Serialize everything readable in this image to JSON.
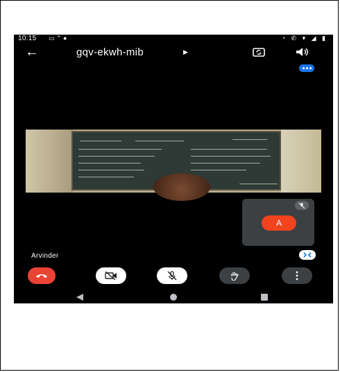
{
  "status_bar": {
    "time": "10:15"
  },
  "header": {
    "meeting_code": "gqv-ekwh-mib"
  },
  "participant": {
    "name": "Arvinder"
  },
  "self_view": {
    "avatar_letter": "A"
  },
  "colors": {
    "end_call": "#ea4335",
    "accent": "#1a73e8",
    "avatar": "#f0431e"
  },
  "icons": [
    "back-arrow-icon",
    "chevron-right-icon",
    "switch-camera-icon",
    "speaker-icon",
    "more-options-icon",
    "mic-off-icon",
    "camera-off-icon",
    "raise-hand-icon",
    "end-call-icon",
    "pin-icon"
  ]
}
